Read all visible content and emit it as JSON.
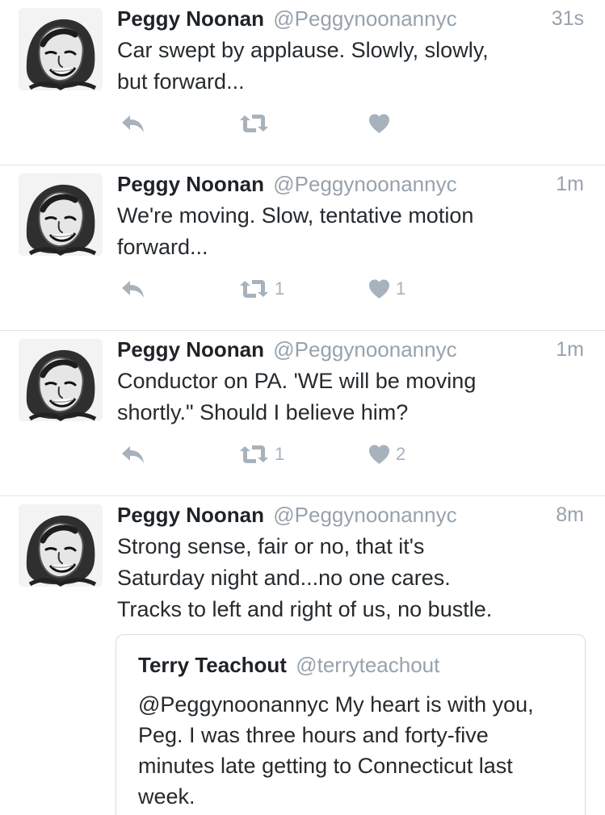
{
  "tweets": [
    {
      "name": "Peggy Noonan",
      "handle": "@Peggynoonannyc",
      "time": "31s",
      "text": "Car swept by applause. Slowly, slowly,\nbut forward...",
      "retweets": "",
      "likes": ""
    },
    {
      "name": "Peggy Noonan",
      "handle": "@Peggynoonannyc",
      "time": "1m",
      "text": "We're moving.  Slow, tentative motion\nforward...",
      "retweets": "1",
      "likes": "1"
    },
    {
      "name": "Peggy Noonan",
      "handle": "@Peggynoonannyc",
      "time": "1m",
      "text": "Conductor on PA. 'WE will be moving\nshortly.\"  Should I believe him?",
      "retweets": "1",
      "likes": "2"
    },
    {
      "name": "Peggy Noonan",
      "handle": "@Peggynoonannyc",
      "time": "8m",
      "text": "Strong sense, fair or no, that it's\nSaturday night and...no one cares.\nTracks to left and right of us, no bustle.",
      "quote": {
        "name": "Terry Teachout",
        "handle": "@terryteachout",
        "text": "@Peggynoonannyc My heart is with you, Peg. I was three hours and forty-five minutes late getting to Connecticut last week."
      }
    }
  ],
  "icons": {
    "reply": "reply-icon",
    "retweet": "retweet-icon",
    "like": "heart-icon",
    "avatar": "avatar"
  },
  "colors": {
    "name": "#1f2327",
    "muted": "#98a2ad",
    "icon": "#a7b2bc",
    "divider": "#dfe3e7"
  }
}
